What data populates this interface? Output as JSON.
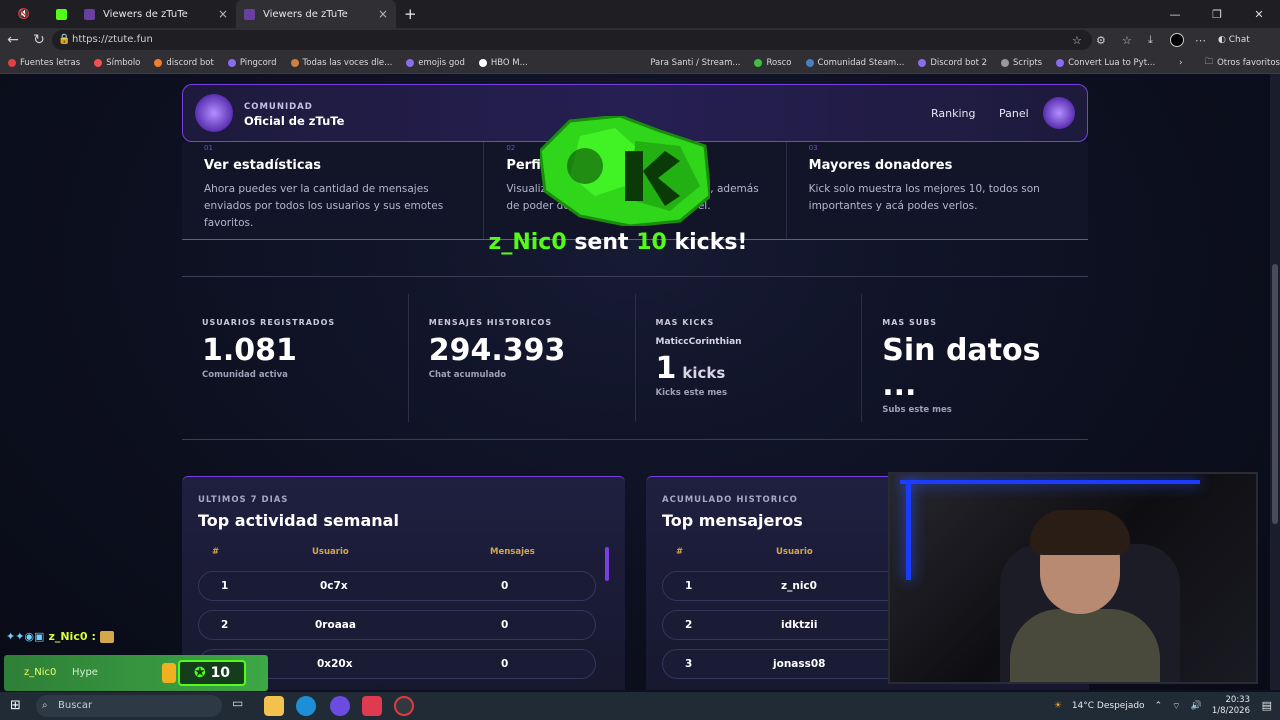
{
  "browser": {
    "tabs": [
      {
        "label": ""
      },
      {
        "label": "Viewers de zTuTe"
      },
      {
        "label": "Viewers de zTuTe"
      }
    ],
    "url": "https://ztute.fun",
    "bookmarks": [
      "Fuentes letras",
      "Símbolo",
      "discord bot",
      "Pingcord",
      "Todas las voces dle...",
      "emojis god",
      "HBO M...",
      "Para Santi / Stream...",
      "Rosco",
      "Comunidad Steam...",
      "Discord bot 2",
      "Scripts",
      "Convert Lua to Pyt..."
    ],
    "other_favorites": "Otros favoritos",
    "chat_label": "Chat"
  },
  "header": {
    "community_label": "COMUNIDAD",
    "community_name": "Oficial de zTuTe",
    "nav": [
      "Ranking",
      "Panel"
    ]
  },
  "features": [
    {
      "num": "01",
      "title": "Ver estadísticas",
      "desc": "Ahora puedes ver la cantidad de mensajes enviados por todos los usuarios y sus emotes favoritos."
    },
    {
      "num": "02",
      "title": "Perfil de usuarios",
      "desc": "Visualiza el perfil de todos los usuarios, además de poder dejarles un comentario en él."
    },
    {
      "num": "03",
      "title": "Mayores donadores",
      "desc": "Kick solo muestra los mejores 10, todos son importantes y acá podes verlos."
    }
  ],
  "alert": {
    "user": "z_Nic0",
    "sent": "sent",
    "count": "10",
    "unit": "kicks!"
  },
  "stats": {
    "users": {
      "label": "USUARIOS REGISTRADOS",
      "value": "1.081",
      "sub": "Comunidad activa"
    },
    "messages": {
      "label": "MENSAJES HISTORICOS",
      "value": "294.393",
      "sub": "Chat acumulado"
    },
    "kicks": {
      "label": "MAS KICKS",
      "name": "MaticcCorinthian",
      "value": "1",
      "unit": "kicks",
      "sub": "Kicks este mes"
    },
    "subs": {
      "label": "MAS SUBS",
      "value": "Sin datos ...",
      "sub": "Subs este mes"
    }
  },
  "weekly": {
    "subtitle": "ULTIMOS 7 DIAS",
    "title": "Top actividad semanal",
    "columns": [
      "#",
      "Usuario",
      "Mensajes"
    ],
    "rows": [
      {
        "rank": "1",
        "user": "0c7x",
        "msgs": "0"
      },
      {
        "rank": "2",
        "user": "0roaaa",
        "msgs": "0"
      },
      {
        "rank": "3",
        "user": "0x20x",
        "msgs": "0"
      }
    ]
  },
  "historic": {
    "subtitle": "ACUMULADO HISTORICO",
    "title": "Top mensajeros",
    "columns": [
      "#",
      "Usuario"
    ],
    "rows": [
      {
        "rank": "1",
        "user": "z_nic0"
      },
      {
        "rank": "2",
        "user": "idktzii"
      },
      {
        "rank": "3",
        "user": "jonass08"
      }
    ]
  },
  "overlay": {
    "chat_user": "z_Nic0",
    "hype_name": "z_Nic0",
    "hype_label": "Hype",
    "hype_count": "10"
  },
  "taskbar": {
    "search": "Buscar",
    "weather": "14°C  Despejado",
    "time": "20:33",
    "date": "1/8/2026"
  },
  "colors": {
    "accent": "#7a3fe0",
    "kick_green": "#53fc18",
    "gold": "#d4a84a"
  }
}
